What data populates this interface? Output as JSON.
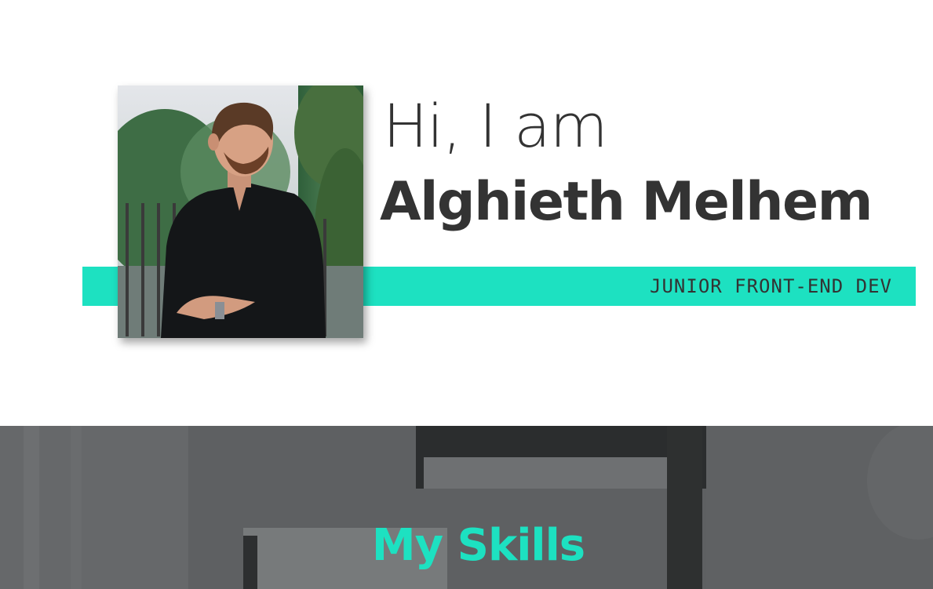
{
  "hero": {
    "greeting": "Hi, I am",
    "name": "Alghieth Melhem",
    "role": "JUNIOR FRONT-END DEV",
    "photo_alt": "Portrait photo"
  },
  "skills": {
    "title": "My Skills"
  },
  "colors": {
    "accent": "#1de1c1",
    "text": "#333333",
    "skills_overlay": "#5b5d5f"
  }
}
